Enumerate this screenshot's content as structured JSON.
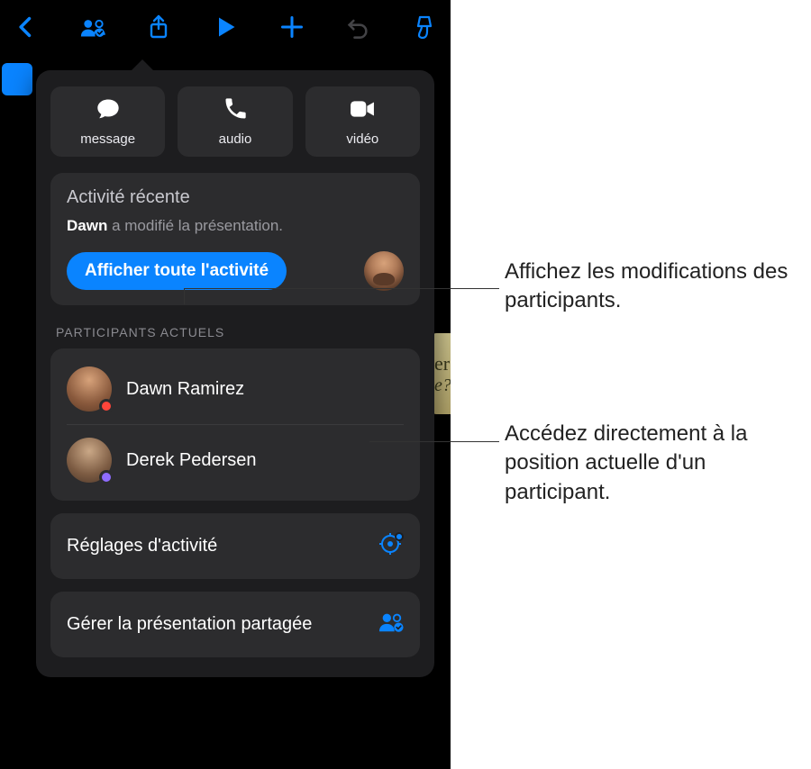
{
  "toolbar": {
    "icons": [
      "back-icon",
      "collaborate-icon",
      "share-icon",
      "play-icon",
      "add-icon",
      "undo-icon",
      "brush-icon"
    ]
  },
  "doc_peek": {
    "line1": "er",
    "line2": "e?"
  },
  "popover": {
    "contact": {
      "message": "message",
      "audio": "audio",
      "video": "vidéo"
    },
    "activity": {
      "title": "Activité récente",
      "actor": "Dawn",
      "rest": " a modifié la présentation.",
      "show_all": "Afficher toute l'activité"
    },
    "participants_label": "PARTICIPANTS ACTUELS",
    "participants": [
      {
        "name": "Dawn Ramirez",
        "dot": "red"
      },
      {
        "name": "Derek Pedersen",
        "dot": "purple"
      }
    ],
    "settings": {
      "activity_settings": "Réglages d'activité",
      "manage_shared": "Gérer la présentation partagée"
    }
  },
  "callouts": {
    "c1": "Affichez les modifications des participants.",
    "c2": "Accédez directement à la position actuelle d'un participant."
  },
  "colors": {
    "accent": "#0a84ff"
  }
}
